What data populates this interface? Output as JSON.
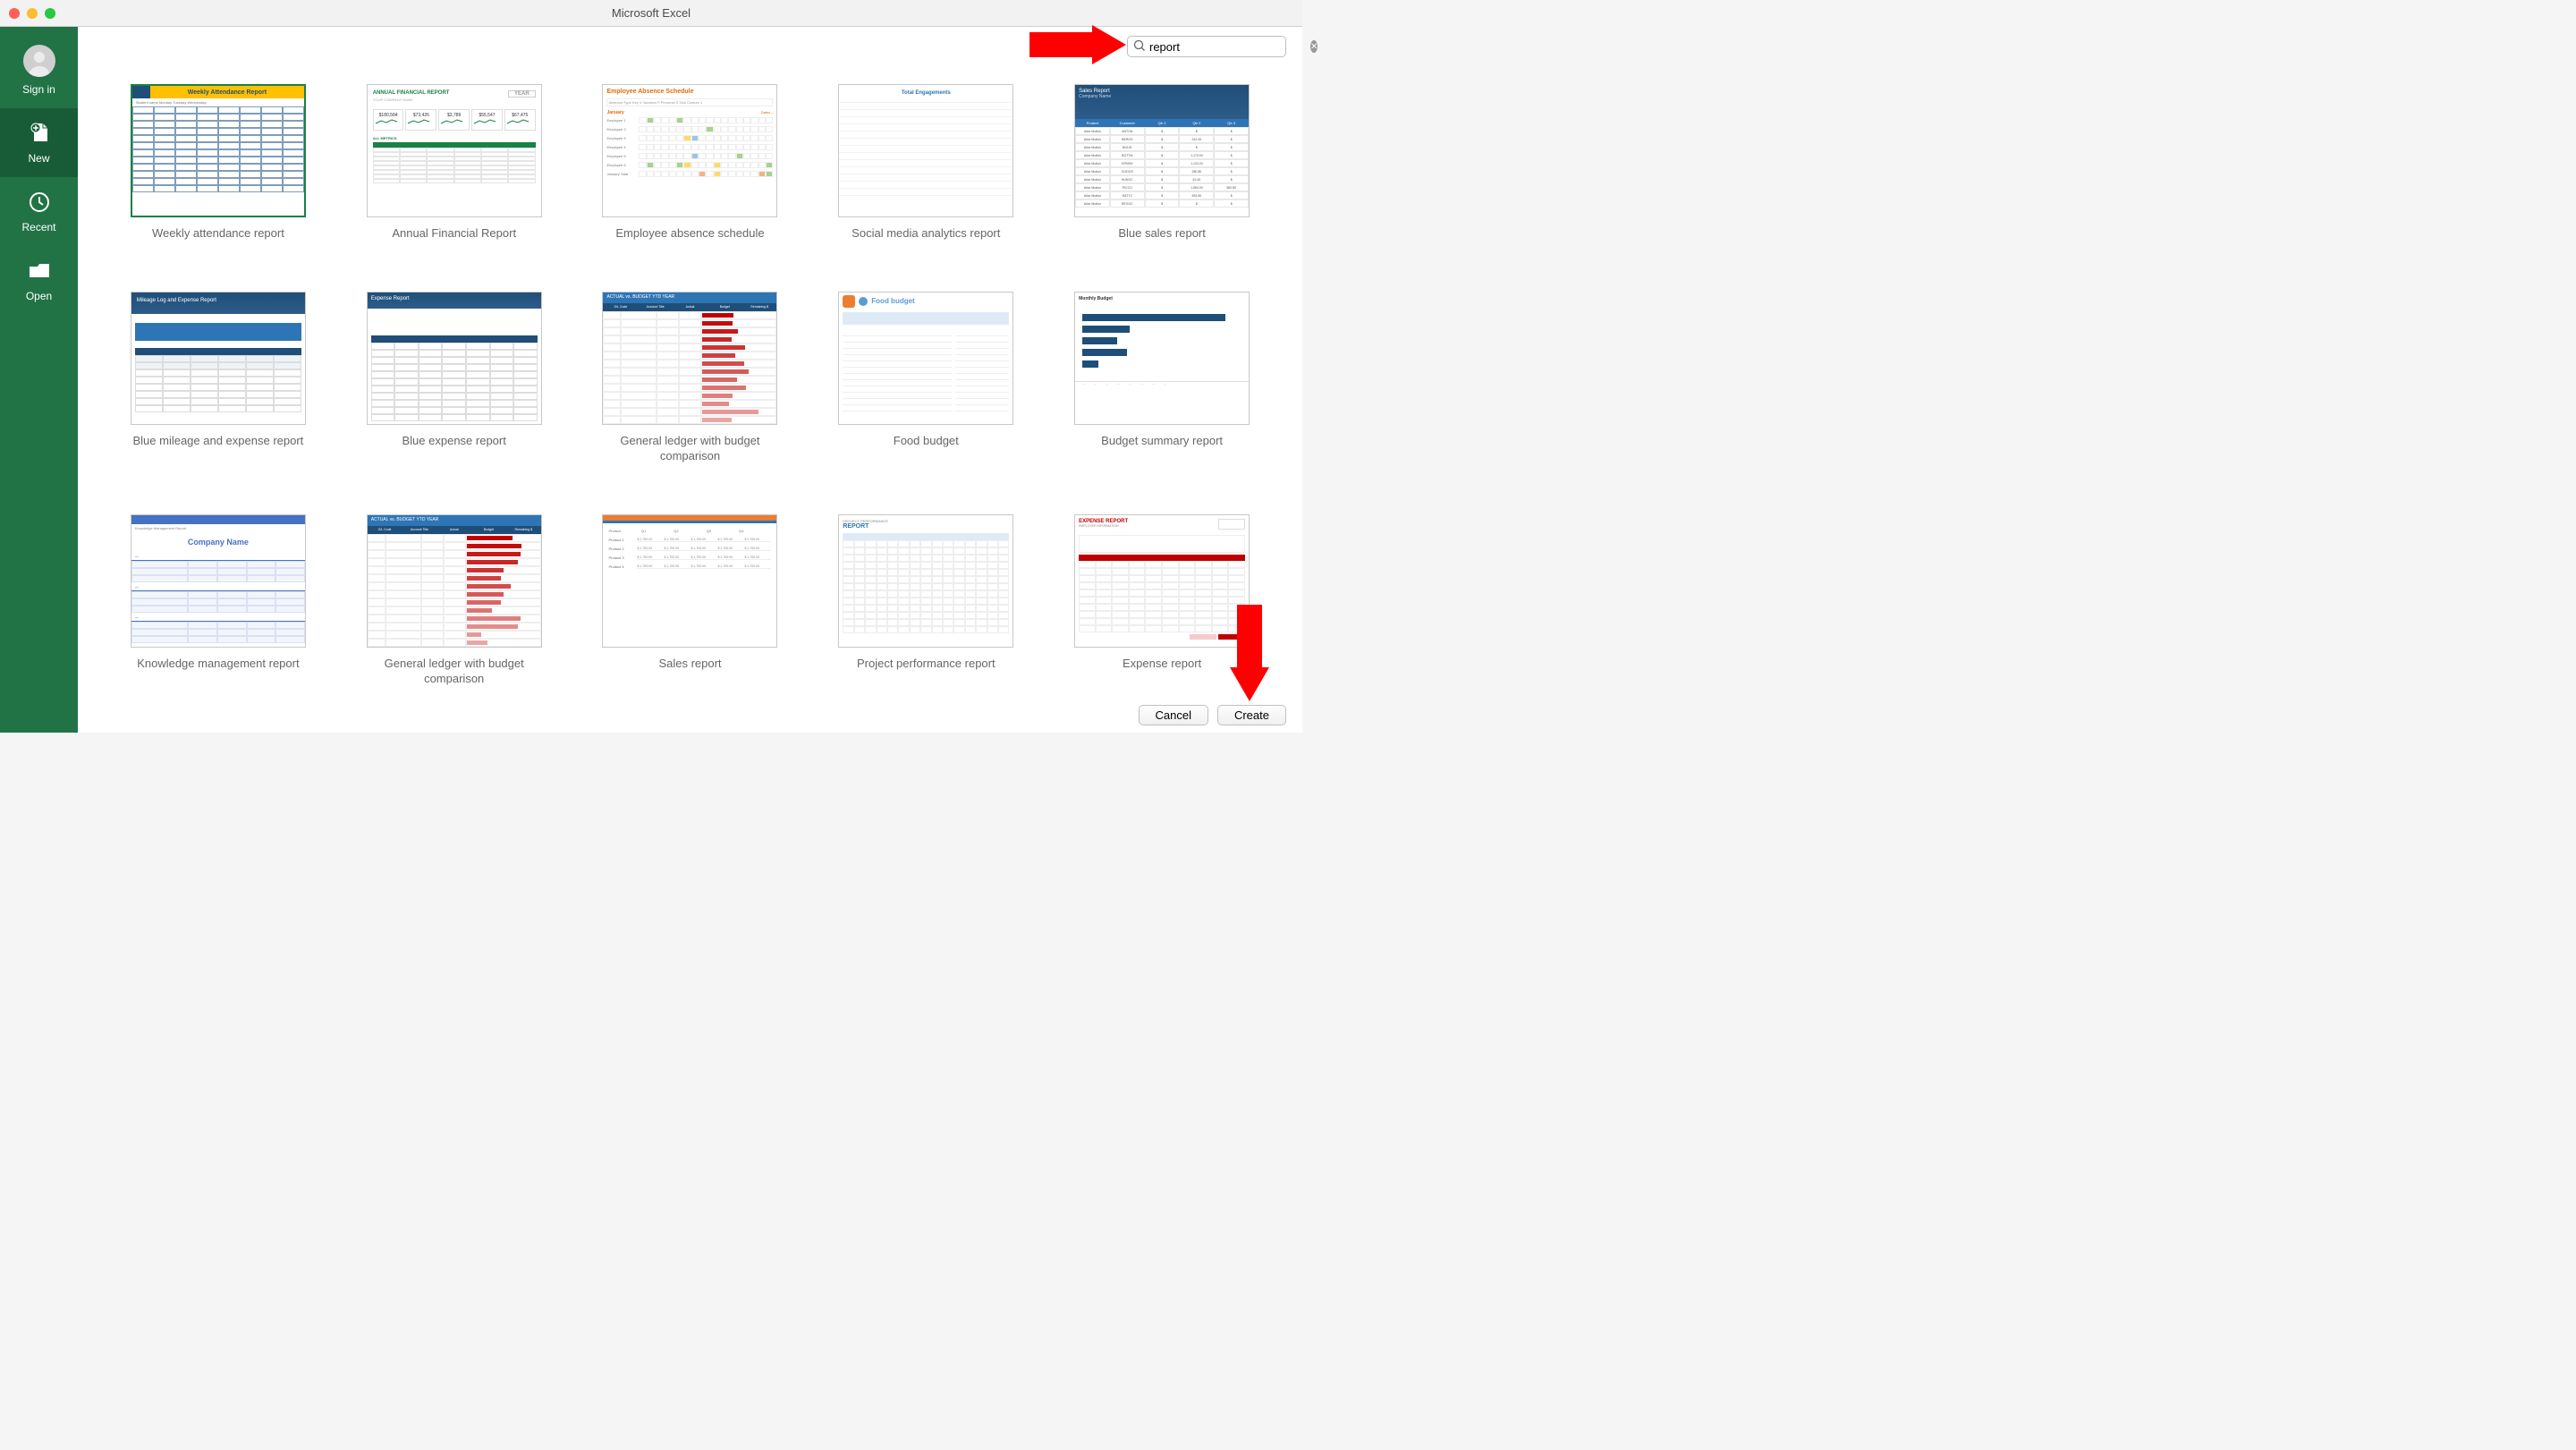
{
  "titlebar": {
    "title": "Microsoft Excel"
  },
  "sidebar": {
    "items": [
      {
        "label": "Sign in"
      },
      {
        "label": "New"
      },
      {
        "label": "Recent"
      },
      {
        "label": "Open"
      }
    ]
  },
  "search": {
    "value": "report"
  },
  "templates": [
    {
      "label": "Weekly attendance report",
      "selected": true,
      "thumb": "weekly_attendance"
    },
    {
      "label": "Annual Financial Report",
      "thumb": "annual_financial"
    },
    {
      "label": "Employee absence schedule",
      "thumb": "employee_absence"
    },
    {
      "label": "Social media analytics report",
      "thumb": "social_media"
    },
    {
      "label": "Blue sales report",
      "thumb": "blue_sales"
    },
    {
      "label": "Blue mileage and expense report",
      "thumb": "blue_mileage"
    },
    {
      "label": "Blue expense report",
      "thumb": "blue_expense"
    },
    {
      "label": "General ledger with budget comparison",
      "thumb": "general_ledger_1"
    },
    {
      "label": "Food budget",
      "thumb": "food_budget"
    },
    {
      "label": "Budget summary report",
      "thumb": "budget_summary"
    },
    {
      "label": "Knowledge management report",
      "thumb": "knowledge_mgmt"
    },
    {
      "label": "General ledger with budget comparison",
      "thumb": "general_ledger_2"
    },
    {
      "label": "Sales report",
      "thumb": "sales_report"
    },
    {
      "label": "Project performance report",
      "thumb": "project_perf"
    },
    {
      "label": "Expense report",
      "thumb": "expense_report"
    }
  ],
  "buttons": {
    "cancel": "Cancel",
    "create": "Create"
  },
  "thumb_text": {
    "weekly_attendance": {
      "title": "Weekly Attendance Report",
      "sub": "Student name   Monday   Tuesday   Wednesday"
    },
    "annual_financial": {
      "title": "ANNUAL FINANCIAL REPORT",
      "company": "YOUR COMPANY NAME",
      "year": "YEAR",
      "boxes": [
        "$180,584",
        "$73,426",
        "$3,789",
        "$55,547",
        "$67,475"
      ],
      "metrics": "ALL METRICS"
    },
    "employee_absence": {
      "title": "Employee Absence Schedule",
      "month": "January",
      "dates": "Dates –",
      "rows": [
        "Employee 1",
        "Employee 2",
        "Employee 3",
        "Employee 4",
        "Employee 5",
        "Employee 6",
        "January Total"
      ],
      "legend": "Absence Type Key   V Vacation   P Personal   S Sick   Custom 1"
    },
    "social_media": {
      "title": "Total Engagements"
    },
    "blue_sales": {
      "title": "Sales Report",
      "company": "Company Name",
      "cols": [
        "Product",
        "Customer",
        "Qtr 1",
        "Qtr 2",
        "Qtr 3"
      ],
      "rows": [
        [
          "Alice Mutton",
          "ANTON",
          "$",
          "$",
          "$"
        ],
        [
          "Alice Mutton",
          "BERGS",
          "$",
          "312.00",
          "$"
        ],
        [
          "Alice Mutton",
          "BOLID",
          "$",
          "$",
          "$"
        ],
        [
          "Alice Mutton",
          "BOTTM",
          "$",
          "1,170.00",
          "$"
        ],
        [
          "Alice Mutton",
          "ERNSH",
          "$",
          "1,123.20",
          "$"
        ],
        [
          "Alice Mutton",
          "GODOS",
          "$",
          "280.80",
          "$"
        ],
        [
          "Alice Mutton",
          "HUNGC",
          "$",
          "62.40",
          "$"
        ],
        [
          "Alice Mutton",
          "PICCO",
          "$",
          "1,560.00",
          "560.80"
        ],
        [
          "Alice Mutton",
          "RATTC",
          "$",
          "592.80",
          "$"
        ],
        [
          "Alice Mutton",
          "REGGC",
          "$",
          "$",
          "$"
        ]
      ]
    },
    "blue_mileage": {
      "title": "Mileage Log and Expense Report"
    },
    "blue_expense": {
      "title": "Expense Report"
    },
    "general_ledger_1": {
      "bar": "ACTUAL vs. BUDGET YTD    YEAR",
      "cols": [
        "G/L Code",
        "Account Title",
        "Actual",
        "Budget",
        "Remaining $"
      ]
    },
    "food_budget": {
      "title": "Food budget"
    },
    "budget_summary": {
      "title": "Monthly Budget"
    },
    "knowledge_mgmt": {
      "title": "Company Name",
      "sub": "Knowledge Management Report"
    },
    "general_ledger_2": {
      "bar": "ACTUAL vs. BUDGET YTD    YEAR",
      "cols": [
        "G/L Code",
        "Account Title",
        "Actual",
        "Budget",
        "Remaining $"
      ]
    },
    "sales_report": {
      "cols": [
        "Product",
        "Q1",
        "Q2",
        "Q3",
        "Q4"
      ],
      "rows": [
        "Product 1",
        "Product 2",
        "Product 3",
        "Product 4"
      ]
    },
    "project_perf": {
      "title": "PROJECT PERFORMANCE",
      "sub": "REPORT"
    },
    "expense_report": {
      "title": "EXPENSE REPORT",
      "sub": "EMPLOYEE INFORMATION"
    }
  }
}
